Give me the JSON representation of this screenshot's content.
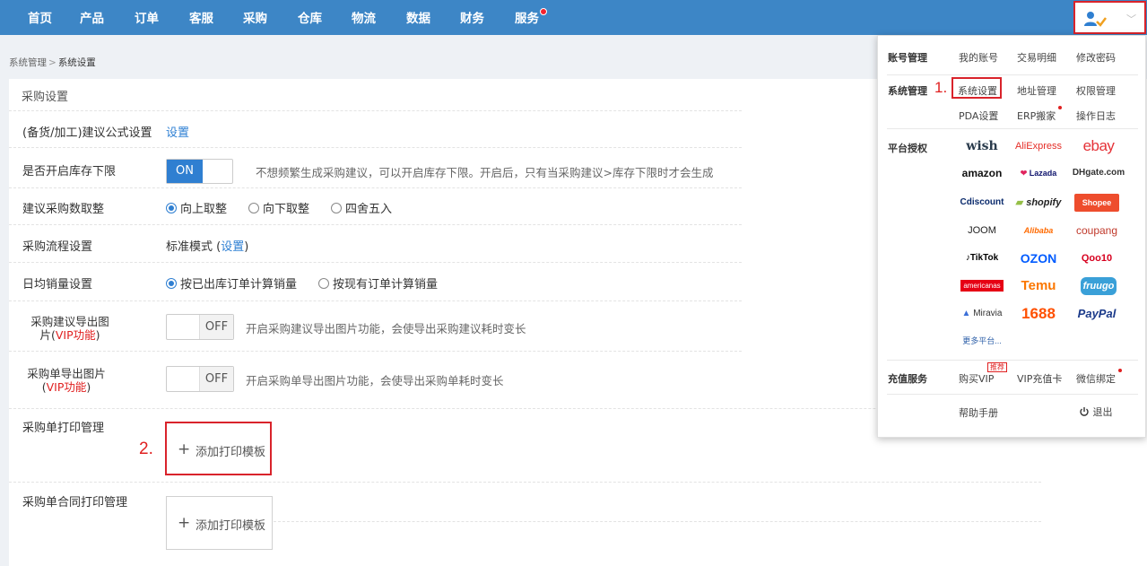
{
  "nav": {
    "items": [
      "首页",
      "产品",
      "订单",
      "客服",
      "采购",
      "仓库",
      "物流",
      "数据",
      "财务",
      "服务"
    ],
    "user_chevron": "﹀"
  },
  "breadcrumb": {
    "parent": "系统管理",
    "current": "系统设置"
  },
  "panel": {
    "title": "采购设置",
    "rows": {
      "formula": {
        "label": "(备货/加工)建议公式设置",
        "link": "设置"
      },
      "stock_limit": {
        "label": "是否开启库存下限",
        "toggle": "ON",
        "hint": "不想频繁生成采购建议，可以开启库存下限。开启后，只有当采购建议>库存下限时才会生成"
      },
      "rounding": {
        "label": "建议采购数取整",
        "options": [
          "向上取整",
          "向下取整",
          "四舍五入"
        ],
        "selected": "向上取整"
      },
      "flow": {
        "label": "采购流程设置",
        "value_prefix": "标准模式 (",
        "link": "设置",
        "value_suffix": ")"
      },
      "daily_sales": {
        "label": "日均销量设置",
        "options": [
          "按已出库订单计算销量",
          "按现有订单计算销量"
        ],
        "selected": "按已出库订单计算销量"
      },
      "suggest_export": {
        "label_line1": "采购建议导出图",
        "label_line2": "片(",
        "vip": "VIP功能",
        "label_end": ")",
        "toggle": "OFF",
        "hint": "开启采购建议导出图片功能，会使导出采购建议耗时变长"
      },
      "order_export": {
        "label_line1": "采购单导出图片",
        "label_pre": "(",
        "vip": "VIP功能",
        "label_end": ")",
        "toggle": "OFF",
        "hint": "开启采购单导出图片功能，会使导出采购单耗时变长"
      },
      "print": {
        "label": "采购单打印管理",
        "button": "添加打印模板",
        "plus": "+",
        "annotation": "2."
      },
      "contract_print": {
        "label": "采购单合同打印管理",
        "button": "添加打印模板",
        "plus": "+"
      }
    }
  },
  "dropdown": {
    "account": {
      "heading": "账号管理",
      "items": [
        "我的账号",
        "交易明细",
        "修改密码"
      ]
    },
    "system": {
      "heading": "系统管理",
      "annotation": "1.",
      "items": [
        "系统设置",
        "地址管理",
        "权限管理",
        "PDA设置",
        "ERP搬家",
        "操作日志"
      ]
    },
    "platforms": {
      "heading": "平台授权",
      "logos": [
        "wish",
        "AliExpress",
        "ebay",
        "amazon",
        "Lazada",
        "DHgate.com",
        "Cdiscount",
        "shopify",
        "Shopee",
        "JOOM",
        "Alibaba",
        "coupang",
        "TikTok",
        "OZON",
        "Qoo10",
        "americanas",
        "Temu",
        "fruugo",
        "Miravia",
        "1688",
        "PayPal",
        "更多平台..."
      ]
    },
    "recharge": {
      "heading": "充值服务",
      "items": [
        "购买VIP",
        "VIP充值卡",
        "微信绑定"
      ],
      "badge": "推荐"
    },
    "help": "帮助手册",
    "logout": "退出"
  },
  "colors": {
    "nav_bg": "#3d86c6",
    "accent": "#2f7fd1",
    "highlight": "#d9232b"
  }
}
